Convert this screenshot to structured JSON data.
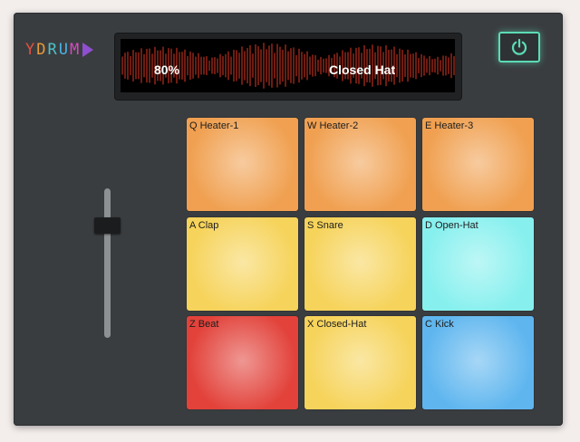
{
  "logo": {
    "letters": [
      {
        "ch": "Y",
        "color": "#e4503f"
      },
      {
        "ch": "D",
        "color": "#e89a3a"
      },
      {
        "ch": "R",
        "color": "#4ec0c7"
      },
      {
        "ch": "U",
        "color": "#4ab3e5"
      },
      {
        "ch": "M",
        "color": "#d54ac0"
      }
    ],
    "arrow_color": "#8f4fd0"
  },
  "display": {
    "volume": "80%",
    "sound": "Closed Hat"
  },
  "power": {
    "icon": "power-icon",
    "color": "#5cdcb4"
  },
  "slider": {
    "level": 0.78
  },
  "pads": [
    {
      "label": "Q Heater-1",
      "color": "#f0a050"
    },
    {
      "label": "W Heater-2",
      "color": "#f0a050"
    },
    {
      "label": "E Heater-3",
      "color": "#f0a050"
    },
    {
      "label": "A Clap",
      "color": "#f6d35a"
    },
    {
      "label": "S Snare",
      "color": "#f6d35a"
    },
    {
      "label": "D Open-Hat",
      "color": "#87f0ee"
    },
    {
      "label": "Z Beat",
      "color": "#e2423a"
    },
    {
      "label": "X Closed-Hat",
      "color": "#f6d35a"
    },
    {
      "label": "C Kick",
      "color": "#5fb6ef"
    }
  ]
}
